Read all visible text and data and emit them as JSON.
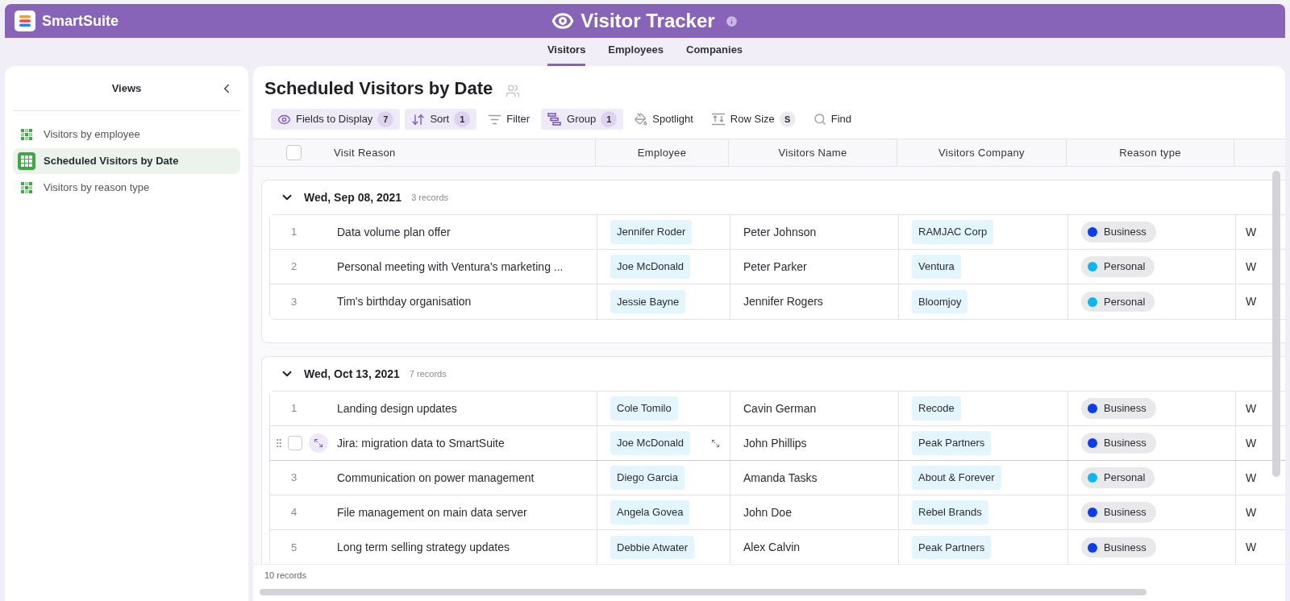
{
  "app": {
    "name": "SmartSuite"
  },
  "header": {
    "title": "Visitor Tracker"
  },
  "tabs": [
    {
      "label": "Visitors",
      "selected": true
    },
    {
      "label": "Employees",
      "selected": false
    },
    {
      "label": "Companies",
      "selected": false
    }
  ],
  "sidebar": {
    "title": "Views",
    "items": [
      {
        "label": "Visitors by employee",
        "selected": false
      },
      {
        "label": "Scheduled Visitors by Date",
        "selected": true
      },
      {
        "label": "Visitors by reason type",
        "selected": false
      }
    ]
  },
  "view": {
    "title": "Scheduled Visitors by Date"
  },
  "toolbar": [
    {
      "kind": "fields",
      "label": "Fields to Display",
      "badge": "7",
      "active": true
    },
    {
      "kind": "sort",
      "label": "Sort",
      "badge": "1",
      "active": true
    },
    {
      "kind": "filter",
      "label": "Filter",
      "active": false
    },
    {
      "kind": "group",
      "label": "Group",
      "badge": "1",
      "active": true
    },
    {
      "kind": "spotlight",
      "label": "Spotlight",
      "active": false
    },
    {
      "kind": "rowsize",
      "label": "Row Size",
      "badge": "S",
      "active": false
    },
    {
      "kind": "find",
      "label": "Find",
      "active": false
    }
  ],
  "table": {
    "select_all": {
      "checked": false
    },
    "columns": [
      "Visit Reason",
      "Employee",
      "Visitors Name",
      "Visitors Company",
      "Reason type"
    ],
    "groups": [
      {
        "label": "Wed, Sep 08, 2021",
        "count": "3 records",
        "expanded": true,
        "rows": [
          {
            "number": "1",
            "hovered": false,
            "reason": "Data volume plan offer",
            "employee": "Jennifer Roder",
            "visitor": "Peter Johnson",
            "company": "RAMJAC Corp",
            "reason_type": {
              "label": "Business",
              "color": "#0a3cf0"
            },
            "column_6": "W"
          },
          {
            "number": "2",
            "hovered": false,
            "reason": "Personal meeting with Ventura's marketing ...",
            "employee": "Joe McDonald",
            "visitor": "Peter Parker",
            "company": "Ventura",
            "reason_type": {
              "label": "Personal",
              "color": "#0cb6f5"
            },
            "column_6": "W"
          },
          {
            "number": "3",
            "hovered": false,
            "reason": "Tim's birthday organisation",
            "employee": "Jessie Bayne",
            "visitor": "Jennifer Rogers",
            "company": "Bloomjoy",
            "reason_type": {
              "label": "Personal",
              "color": "#0cb6f5"
            },
            "column_6": "W"
          }
        ]
      },
      {
        "label": "Wed, Oct 13, 2021",
        "count": "7 records",
        "expanded": true,
        "rows": [
          {
            "number": "1",
            "hovered": false,
            "reason": "Landing design updates",
            "employee": "Cole Tomilo",
            "visitor": "Cavin German",
            "company": "Recode",
            "reason_type": {
              "label": "Business",
              "color": "#0a3cf0"
            },
            "column_6": "W"
          },
          {
            "hovered": true,
            "checked": false,
            "reason": "Jira: migration data to SmartSuite",
            "employee": "Joe McDonald",
            "visitor": "John Phillips",
            "company": "Peak Partners",
            "reason_type": {
              "label": "Business",
              "color": "#0a3cf0"
            },
            "column_6": "W"
          },
          {
            "number": "3",
            "hovered": false,
            "reason": "Communication on power management",
            "employee": "Diego Garcia",
            "visitor": "Amanda Tasks",
            "company": "About & Forever",
            "reason_type": {
              "label": "Personal",
              "color": "#0cb6f5"
            },
            "column_6": "W"
          },
          {
            "number": "4",
            "hovered": false,
            "reason": "File management on main data server",
            "employee": "Angela Govea",
            "visitor": "John Doe",
            "company": "Rebel Brands",
            "reason_type": {
              "label": "Business",
              "color": "#0a3cf0"
            },
            "column_6": "W"
          },
          {
            "number": "5",
            "hovered": false,
            "reason": "Long term selling strategy updates",
            "employee": "Debbie Atwater",
            "visitor": "Alex Calvin",
            "company": "Peak Partners",
            "reason_type": {
              "label": "Business",
              "color": "#0a3cf0"
            },
            "column_6": "W"
          }
        ]
      }
    ]
  },
  "footer": {
    "count": "10 records"
  }
}
